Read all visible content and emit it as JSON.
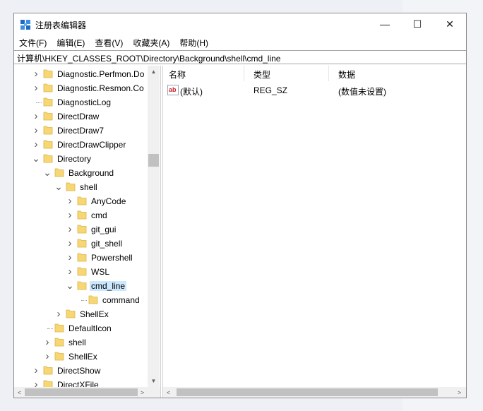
{
  "window": {
    "title": "注册表编辑器",
    "controls": {
      "minimize": "—",
      "maximize": "☐",
      "close": "✕"
    }
  },
  "menu": [
    "文件(F)",
    "编辑(E)",
    "查看(V)",
    "收藏夹(A)",
    "帮助(H)"
  ],
  "address": "计算机\\HKEY_CLASSES_ROOT\\Directory\\Background\\shell\\cmd_line",
  "tree": [
    {
      "label": "Diagnostic.Perfmon.Do",
      "expander": "collapsed",
      "selected": false
    },
    {
      "label": "Diagnostic.Resmon.Co",
      "expander": "collapsed",
      "selected": false
    },
    {
      "label": "DiagnosticLog",
      "expander": "none",
      "selected": false
    },
    {
      "label": "DirectDraw",
      "expander": "collapsed",
      "selected": false
    },
    {
      "label": "DirectDraw7",
      "expander": "collapsed",
      "selected": false
    },
    {
      "label": "DirectDrawClipper",
      "expander": "collapsed",
      "selected": false
    },
    {
      "label": "Directory",
      "expander": "expanded",
      "selected": false
    },
    {
      "label": "Background",
      "expander": "expanded",
      "selected": false
    },
    {
      "label": "shell",
      "expander": "expanded",
      "selected": false
    },
    {
      "label": "AnyCode",
      "expander": "collapsed",
      "selected": false
    },
    {
      "label": "cmd",
      "expander": "collapsed",
      "selected": false
    },
    {
      "label": "git_gui",
      "expander": "collapsed",
      "selected": false
    },
    {
      "label": "git_shell",
      "expander": "collapsed",
      "selected": false
    },
    {
      "label": "Powershell",
      "expander": "collapsed",
      "selected": false
    },
    {
      "label": "WSL",
      "expander": "collapsed",
      "selected": false
    },
    {
      "label": "cmd_line",
      "expander": "expanded",
      "selected": true
    },
    {
      "label": "command",
      "expander": "none",
      "selected": false
    },
    {
      "label": "ShellEx",
      "expander": "collapsed",
      "selected": false
    },
    {
      "label": "DefaultIcon",
      "expander": "none",
      "selected": false
    },
    {
      "label": "shell",
      "expander": "collapsed",
      "selected": false
    },
    {
      "label": "ShellEx",
      "expander": "collapsed",
      "selected": false
    },
    {
      "label": "DirectShow",
      "expander": "collapsed",
      "selected": false
    },
    {
      "label": "DirectXFile",
      "expander": "collapsed",
      "selected": false
    }
  ],
  "list": {
    "columns": [
      "名称",
      "类型",
      "数据"
    ],
    "rows": [
      {
        "icon": "string-value-icon",
        "name": "(默认)",
        "type": "REG_SZ",
        "data": "(数值未设置)"
      }
    ]
  },
  "colors": {
    "selection": "#cce8ff",
    "folder": "#f7d774",
    "scrollbar_thumb": "#c1c1c1"
  }
}
